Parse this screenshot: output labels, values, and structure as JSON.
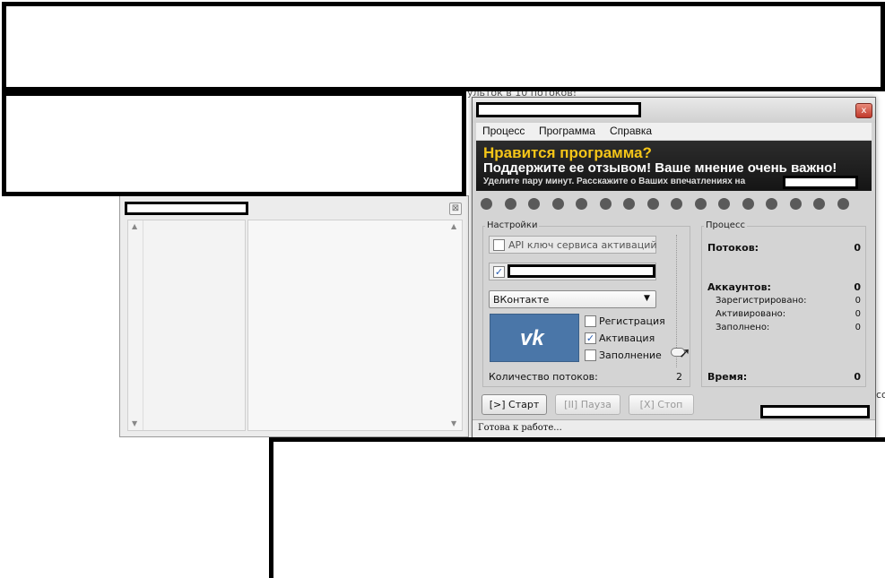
{
  "background": {
    "text_fragment": "ульток в 10 потоков!",
    "right_edge_fragment": "co",
    "blur_line_1": "...",
    "blur_line_2": "..."
  },
  "left_window": {
    "close_glyph": "⊠"
  },
  "app": {
    "close_glyph": "x",
    "menu": [
      "Процесс",
      "Программа",
      "Справка"
    ],
    "banner": {
      "line1": "Нравится программа?",
      "line2": "Поддержите ее отзывом! Ваше мнение очень важно!",
      "line3": "Уделите пару минут. Расскажите о Ваших впечатлениях на"
    },
    "indicator_count": 16,
    "settings": {
      "title": "Настройки",
      "api_key_label": "API ключ сервиса активаций",
      "api_key_checked": false,
      "second_checked": true,
      "service_select": "ВКонтакте",
      "service_logo": "vk-logo",
      "options": [
        {
          "label": "Регистрация",
          "checked": false
        },
        {
          "label": "Активация",
          "checked": true
        },
        {
          "label": "Заполнение",
          "checked": false
        }
      ],
      "threads_label": "Количество потоков:",
      "threads_value": "2",
      "slider_level": 0.08
    },
    "process": {
      "title": "Процесс",
      "threads_label": "Потоков:",
      "threads_value": "0",
      "accounts_label": "Аккаунтов:",
      "accounts_value": "0",
      "registered_label": "Зарегистрировано:",
      "registered_value": "0",
      "activated_label": "Активировано:",
      "activated_value": "0",
      "filled_label": "Заполнено:",
      "filled_value": "0",
      "time_label": "Время:",
      "time_value": "0"
    },
    "buttons": {
      "start": "[>] Старт",
      "pause": "[II] Пауза",
      "stop": "[X] Стоп"
    },
    "status_text": "Готова к работе..."
  },
  "colors": {
    "banner_yellow": "#f5c518",
    "vk_blue": "#4a76a8",
    "check_blue": "#2a5db0"
  }
}
